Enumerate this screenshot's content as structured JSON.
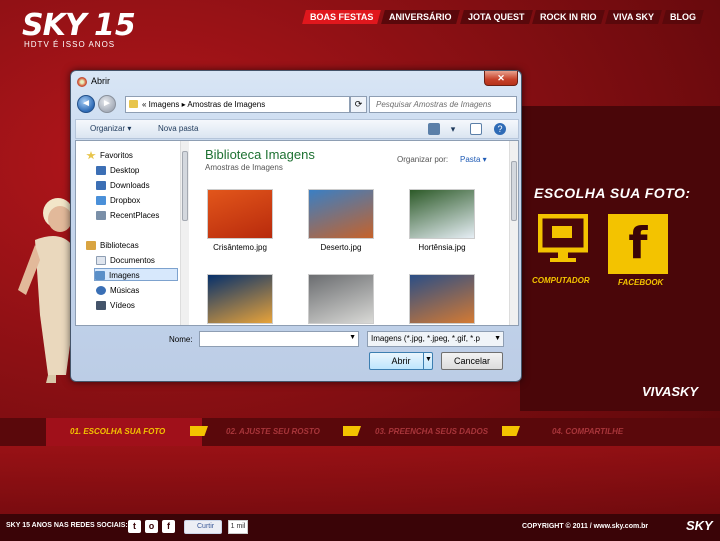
{
  "header": {
    "logo_brand": "SKY",
    "logo_number": "15",
    "logo_tagline": "HDTV É ISSO   ANOS",
    "nav": [
      {
        "label": "BOAS FESTAS",
        "active": true
      },
      {
        "label": "ANIVERSÁRIO",
        "active": false
      },
      {
        "label": "JOTA QUEST",
        "active": false
      },
      {
        "label": "ROCK IN RIO",
        "active": false
      },
      {
        "label": "VIVA SKY",
        "active": false
      },
      {
        "label": "BLOG",
        "active": false
      }
    ]
  },
  "right_panel": {
    "title": "ESCOLHA SUA FOTO:",
    "option_computer": "COMPUTADOR",
    "option_facebook": "FACEBOOK",
    "facebook_glyph": "f",
    "brand": "VIVASKY"
  },
  "steps": [
    {
      "label": "01. ESCOLHA SUA FOTO",
      "active": true
    },
    {
      "label": "02. AJUSTE SEU ROSTO",
      "active": false
    },
    {
      "label": "03. PREENCHA SEUS DADOS",
      "active": false
    },
    {
      "label": "04. COMPARTILHE",
      "active": false
    }
  ],
  "footer": {
    "social_label": "SKY 15 ANOS NAS REDES SOCIAIS:",
    "social_icons": [
      "t",
      "o",
      "f"
    ],
    "like_label": "Curtir",
    "like_count": "1 mil",
    "copyright": "COPYRIGHT © 2011   /   www.sky.com.br",
    "brand": "SKY"
  },
  "dialog": {
    "title": "Abrir",
    "close_glyph": "✕",
    "back_glyph": "◄",
    "forward_glyph": "►",
    "address": "«  Imagens  ▸  Amostras de Imagens",
    "refresh_glyph": "⟳",
    "search_placeholder": "Pesquisar Amostras de Imagens",
    "toolbar": {
      "organize": "Organizar ▾",
      "new_folder": "Nova pasta",
      "help_glyph": "?"
    },
    "sidebar": {
      "favorites": "Favoritos",
      "favorites_items": [
        "Desktop",
        "Downloads",
        "Dropbox",
        "RecentPlaces"
      ],
      "libraries": "Bibliotecas",
      "libraries_items": [
        "Documentos",
        "Imagens",
        "Músicas",
        "Vídeos"
      ]
    },
    "library_title": "Biblioteca Imagens",
    "library_subtitle": "Amostras de Imagens",
    "arrange_label": "Organizar por:",
    "arrange_value": "Pasta  ▾",
    "files": [
      {
        "name": "Crisântemo.jpg",
        "colors": [
          "#e2561b",
          "#b82a0c"
        ]
      },
      {
        "name": "Deserto.jpg",
        "colors": [
          "#3a7fc4",
          "#c6622a"
        ]
      },
      {
        "name": "Hortênsia.jpg",
        "colors": [
          "#2d5a28",
          "#e6eef5"
        ]
      },
      {
        "name": "",
        "colors": [
          "#06306b",
          "#e8a33a"
        ]
      },
      {
        "name": "",
        "colors": [
          "#6b6d70",
          "#d9d9d6"
        ]
      },
      {
        "name": "",
        "colors": [
          "#2b4e86",
          "#d47a33"
        ]
      }
    ],
    "name_label": "Nome:",
    "name_value": "",
    "filter_value": "Imagens (*.jpg, *.jpeg, *.gif, *.p",
    "open_button": "Abrir",
    "cancel_button": "Cancelar"
  }
}
